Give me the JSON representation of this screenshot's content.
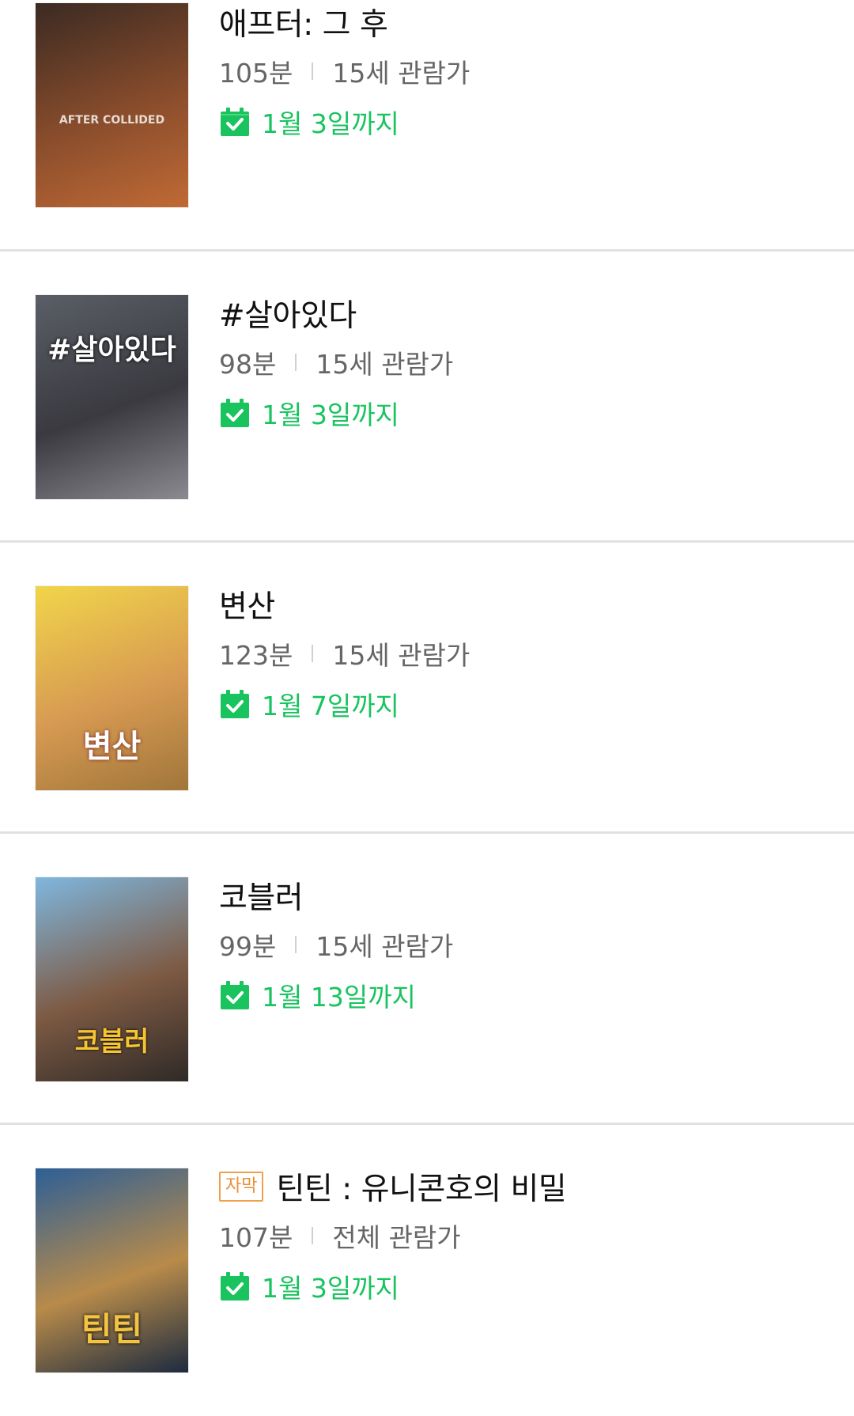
{
  "movies": [
    {
      "title": "애프터: 그 후",
      "subtitle_badge": "",
      "runtime": "105분",
      "rating": "15세 관람가",
      "until": "1월 3일까지",
      "poster_text": "AFTER COLLIDED",
      "poster_colors": [
        "#3b2a22",
        "#8a4d2c",
        "#c06a35"
      ]
    },
    {
      "title": "#살아있다",
      "subtitle_badge": "",
      "runtime": "98분",
      "rating": "15세 관람가",
      "until": "1월 3일까지",
      "poster_text": "#살아있다",
      "poster_colors": [
        "#5a5e66",
        "#3a3a40",
        "#8a8a90"
      ]
    },
    {
      "title": "변산",
      "subtitle_badge": "",
      "runtime": "123분",
      "rating": "15세 관람가",
      "until": "1월 7일까지",
      "poster_text": "변산",
      "poster_colors": [
        "#f1d54a",
        "#d79a52",
        "#a0763a"
      ]
    },
    {
      "title": "코블러",
      "subtitle_badge": "",
      "runtime": "99분",
      "rating": "15세 관람가",
      "until": "1월 13일까지",
      "poster_text": "코블러",
      "poster_colors": [
        "#7fb7df",
        "#7d5a43",
        "#2f2a27"
      ]
    },
    {
      "title": "틴틴 : 유니콘호의 비밀",
      "subtitle_badge": "자막",
      "runtime": "107분",
      "rating": "전체 관람가",
      "until": "1월 3일까지",
      "poster_text": "틴틴",
      "poster_colors": [
        "#2d5f96",
        "#b88b4a",
        "#1d2b3f"
      ]
    }
  ],
  "accent_color": "#19c35e",
  "badge_color": "#f0a04b",
  "icons": {
    "until": "calendar-check-icon"
  }
}
